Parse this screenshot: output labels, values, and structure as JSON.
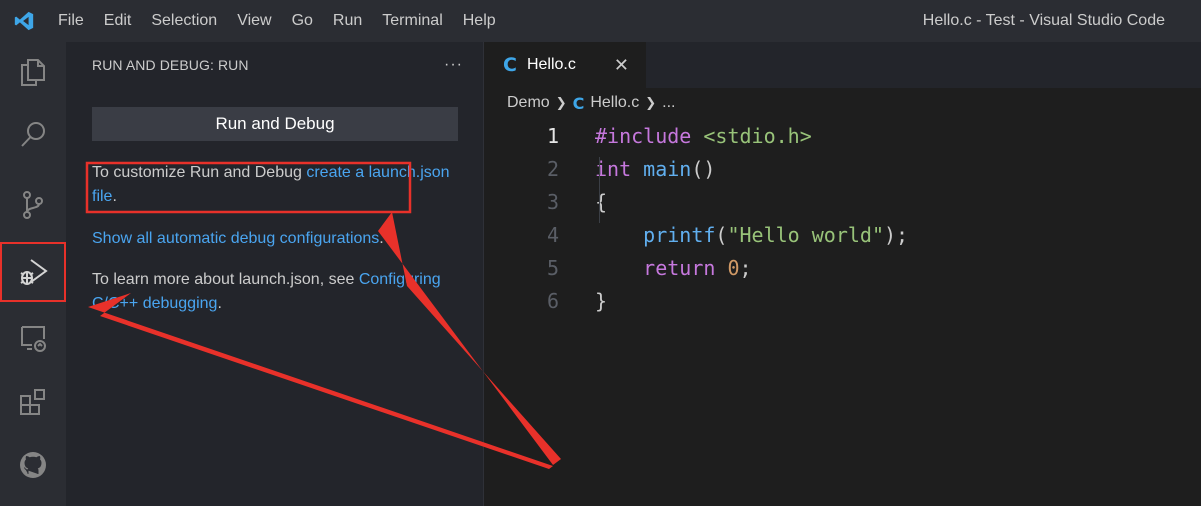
{
  "titlebar": {
    "logo_icon": "vscode-logo-icon",
    "menu": [
      "File",
      "Edit",
      "Selection",
      "View",
      "Go",
      "Run",
      "Terminal",
      "Help"
    ],
    "window_title": "Hello.c - Test - Visual Studio Code"
  },
  "activitybar": {
    "items": [
      {
        "icon": "explorer-icon"
      },
      {
        "icon": "search-icon"
      },
      {
        "icon": "source-control-icon"
      },
      {
        "icon": "run-debug-icon",
        "active": true
      },
      {
        "icon": "remote-explorer-icon"
      },
      {
        "icon": "extensions-icon"
      },
      {
        "icon": "github-icon"
      }
    ]
  },
  "sidebar": {
    "title": "RUN AND DEBUG: RUN",
    "more": "···",
    "run_button": "Run and Debug",
    "para1_text": "To customize Run and Debug ",
    "para1_link": "create a launch.json file",
    "para1_end": ".",
    "para2_link": "Show all automatic debug configurations",
    "para2_end": ".",
    "para3_text": "To learn more about launch.json, see ",
    "para3_link": "Configuring C/C++ debugging",
    "para3_end": "."
  },
  "editor": {
    "tab_icon": "C",
    "tab_label": "Hello.c",
    "tab_close": "✕",
    "breadcrumb": {
      "folder": "Demo",
      "file_icon": "C",
      "file": "Hello.c",
      "rest": "..."
    },
    "lines": [
      {
        "n": "1",
        "parts": [
          [
            "kw-pre",
            "#include"
          ],
          [
            "pn",
            " "
          ],
          [
            "inc",
            "<stdio.h>"
          ]
        ]
      },
      {
        "n": "2",
        "parts": [
          [
            "kw",
            "int"
          ],
          [
            "pn",
            " "
          ],
          [
            "fn",
            "main"
          ],
          [
            "pn",
            "()"
          ]
        ]
      },
      {
        "n": "3",
        "parts": [
          [
            "pn",
            "{"
          ]
        ]
      },
      {
        "n": "4",
        "parts": [
          [
            "pn",
            "    "
          ],
          [
            "fn",
            "printf"
          ],
          [
            "pn",
            "("
          ],
          [
            "str",
            "\"Hello world\""
          ],
          [
            "pn",
            ");"
          ]
        ]
      },
      {
        "n": "5",
        "parts": [
          [
            "pn",
            "    "
          ],
          [
            "kw",
            "return"
          ],
          [
            "pn",
            " "
          ],
          [
            "num",
            "0"
          ],
          [
            "pn",
            ";"
          ]
        ]
      },
      {
        "n": "6",
        "parts": [
          [
            "pn",
            "}"
          ]
        ]
      }
    ]
  },
  "colors": {
    "annotation_red": "#e8312a",
    "link_blue": "#4aa5f0",
    "accent_blue": "#3ea6e8"
  }
}
